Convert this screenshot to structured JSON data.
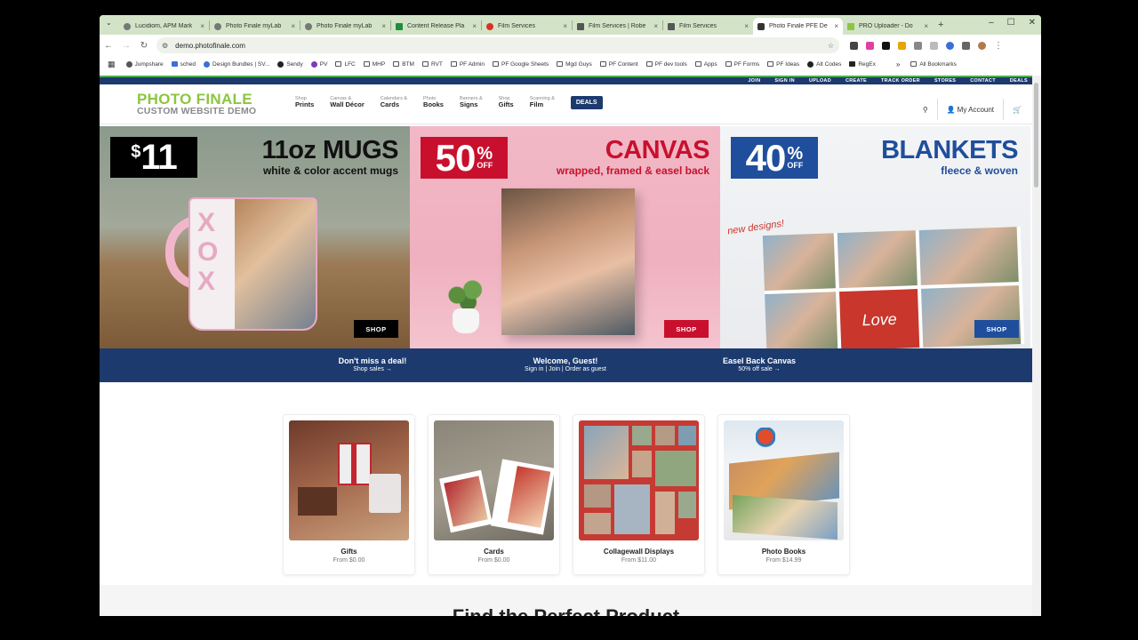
{
  "browser": {
    "tabs": [
      {
        "title": "Lucidiom, APM Mark",
        "icon": "globe-icon",
        "active": false
      },
      {
        "title": "Photo Finale myLab",
        "icon": "globe-icon",
        "active": false
      },
      {
        "title": "Photo Finale myLab",
        "icon": "globe-icon",
        "active": false
      },
      {
        "title": "Content Release Pla",
        "icon": "sheets-icon",
        "active": false
      },
      {
        "title": "Film Services",
        "icon": "g-icon",
        "active": false
      },
      {
        "title": "Film Services | Robe",
        "icon": "doc-icon",
        "active": false
      },
      {
        "title": "Film Services",
        "icon": "doc-icon",
        "active": false
      },
      {
        "title": "Photo Finale PFE De",
        "icon": "camera-icon",
        "active": true
      },
      {
        "title": "PRO Uploader - Do",
        "icon": "pf-icon",
        "active": false
      }
    ],
    "url": "demo.photofinale.com",
    "bookmarks": [
      "Jumpshare",
      "sched",
      "Design Bundles | SV...",
      "Sendy",
      "PV",
      "LFC",
      "MHP",
      "BTM",
      "RVT",
      "PF Admin",
      "PF Google Sheets",
      "Mgd Guys",
      "PF Content",
      "PF dev tools",
      "Apps",
      "PF Forms",
      "PF Ideas",
      "Alt Codes",
      "RegEx"
    ],
    "all_bookmarks": "All Bookmarks"
  },
  "site": {
    "util_links": [
      "JOIN",
      "SIGN IN",
      "UPLOAD",
      "CREATE",
      "TRACK ORDER",
      "STORES",
      "CONTACT",
      "DEALS"
    ],
    "logo": {
      "line1": "PHOTO FINALE",
      "line2": "CUSTOM WEBSITE DEMO"
    },
    "nav": [
      {
        "small": "Shop",
        "big": "Prints"
      },
      {
        "small": "Canvas &",
        "big": "Wall Décor"
      },
      {
        "small": "Calendars &",
        "big": "Cards"
      },
      {
        "small": "Photo",
        "big": "Books"
      },
      {
        "small": "Banners &",
        "big": "Signs"
      },
      {
        "small": "Shop",
        "big": "Gifts"
      },
      {
        "small": "Scanning &",
        "big": "Film"
      }
    ],
    "deals_label": "DEALS",
    "my_account": "My Account",
    "heroes": [
      {
        "badge_symbol": "$",
        "badge": "11",
        "title": "11oz MUGS",
        "subtitle": "white & color accent mugs",
        "shop": "SHOP",
        "badge_color": "#000000",
        "title_color": "#111111"
      },
      {
        "badge": "50",
        "badge_pct": "%",
        "badge_off": "OFF",
        "title": "CANVAS",
        "subtitle": "wrapped, framed & easel back",
        "shop": "SHOP",
        "badge_color": "#c8102e",
        "title_color": "#c8102e"
      },
      {
        "badge": "40",
        "badge_pct": "%",
        "badge_off": "OFF",
        "title": "BLANKETS",
        "subtitle": "fleece & woven",
        "shop": "SHOP",
        "badge_color": "#1f4e9c",
        "title_color": "#1f4e9c",
        "annotation": "new designs!",
        "blanket_text": "Love"
      }
    ],
    "promos": [
      {
        "title": "Don't miss a deal!",
        "sub": "Shop sales →"
      },
      {
        "title": "Welcome, Guest!",
        "sub": "Sign in | Join | Order as guest"
      },
      {
        "title": "Easel Back Canvas",
        "sub": "50% off sale →"
      }
    ],
    "products": [
      {
        "name": "Gifts",
        "price": "From $0.00"
      },
      {
        "name": "Cards",
        "price": "From $0.00"
      },
      {
        "name": "Collagewall Displays",
        "price": "From $11.00"
      },
      {
        "name": "Photo Books",
        "price": "From $14.99"
      }
    ],
    "section_title": "Find the Perfect Product"
  },
  "colors": {
    "navy": "#1c3a6e",
    "green": "#8cc63f",
    "red": "#c8102e",
    "blue": "#1f4e9c"
  }
}
